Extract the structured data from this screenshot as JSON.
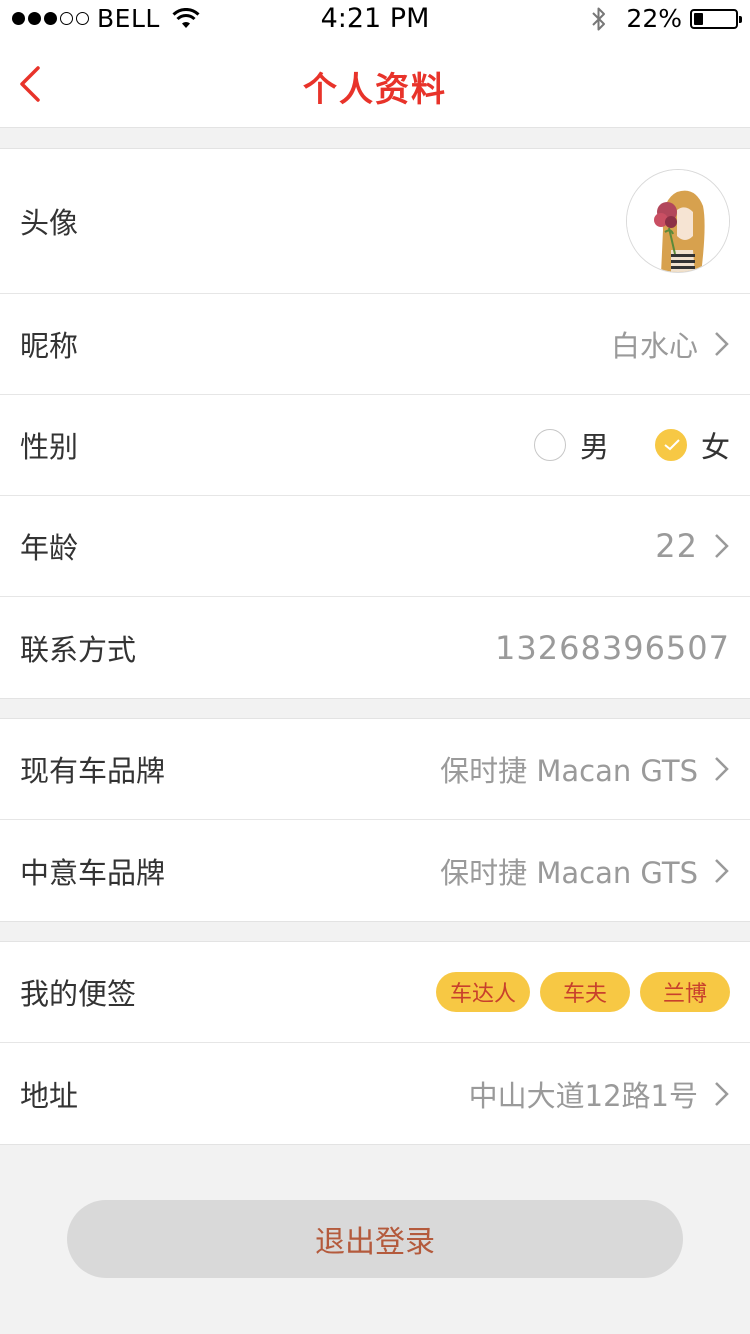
{
  "status_bar": {
    "carrier": "BELL",
    "time": "4:21 PM",
    "battery_text": "22%",
    "battery_level": 0.22,
    "signal_bars_filled": 3,
    "signal_bars_total": 5
  },
  "nav": {
    "title": "个人资料",
    "back_icon": "chevron-left-icon",
    "accent_color": "#e8332a"
  },
  "profile": {
    "avatar_label": "头像",
    "nickname_label": "昵称",
    "nickname_value": "白水心",
    "gender_label": "性别",
    "gender_options": [
      {
        "label": "男",
        "checked": false
      },
      {
        "label": "女",
        "checked": true
      }
    ],
    "age_label": "年龄",
    "age_value": "22",
    "contact_label": "联系方式",
    "contact_value": "13268396507"
  },
  "cars": {
    "current_brand_label": "现有车品牌",
    "current_brand_value": "保时捷 Macan GTS",
    "desired_brand_label": "中意车品牌",
    "desired_brand_value": "保时捷 Macan GTS"
  },
  "extra": {
    "tags_label": "我的便签",
    "tags": [
      "车达人",
      "车夫",
      "兰博"
    ],
    "tag_color": "#f7c844",
    "address_label": "地址",
    "address_value": "中山大道12路1号"
  },
  "logout_label": "退出登录"
}
